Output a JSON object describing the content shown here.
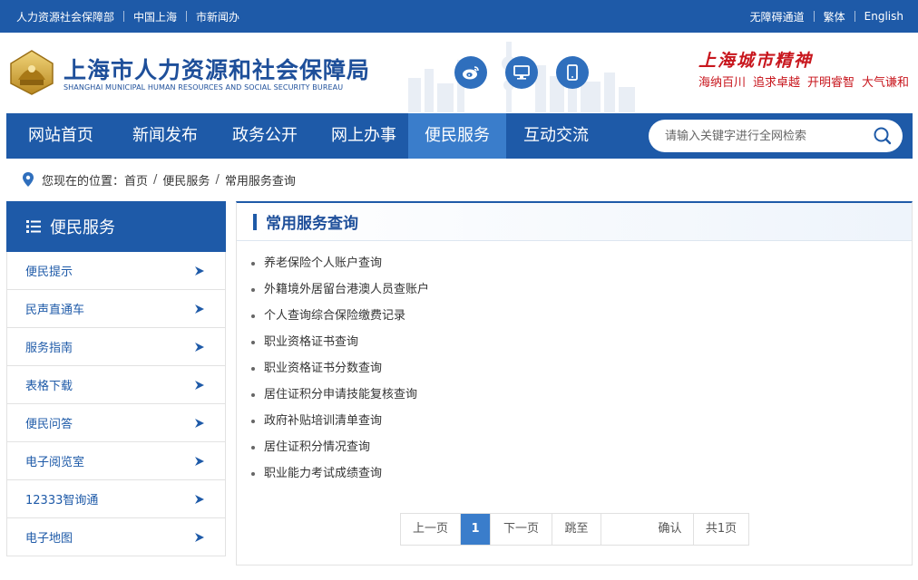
{
  "topbar": {
    "left_links": [
      "人力资源社会保障部",
      "中国上海",
      "市新闻办"
    ],
    "right_links": [
      "无障碍通道",
      "繁体",
      "English"
    ]
  },
  "header": {
    "site_name": "上海市人力资源和社会保障局",
    "site_name_en": "SHANGHAI MUNICIPAL HUMAN RESOURCES AND SOCIAL SECURITY BUREAU",
    "spirit_title": "上海城市精神",
    "spirit_words": [
      "海纳百川",
      "追求卓越",
      "开明睿智",
      "大气谦和"
    ],
    "social_icons": [
      "weibo-icon",
      "pc-icon",
      "mobile-icon"
    ]
  },
  "nav": {
    "items": [
      "网站首页",
      "新闻发布",
      "政务公开",
      "网上办事",
      "便民服务",
      "互动交流"
    ],
    "active": "便民服务",
    "search_placeholder": "请输入关键字进行全网检索"
  },
  "breadcrumb": {
    "label": "您现在的位置：",
    "items": [
      "首页",
      "便民服务",
      "常用服务查询"
    ]
  },
  "sidebar": {
    "title": "便民服务",
    "items": [
      "便民提示",
      "民声直通车",
      "服务指南",
      "表格下载",
      "便民问答",
      "电子阅览室",
      "12333智询通",
      "电子地图"
    ]
  },
  "content": {
    "title": "常用服务查询",
    "items": [
      "养老保险个人账户查询",
      "外籍境外居留台港澳人员查账户",
      "个人查询综合保险缴费记录",
      "职业资格证书查询",
      "职业资格证书分数查询",
      "居住证积分申请技能复核查询",
      "政府补贴培训清单查询",
      "居住证积分情况查询",
      "职业能力考试成绩查询"
    ]
  },
  "pagination": {
    "prev": "上一页",
    "current": "1",
    "next": "下一页",
    "goto": "跳至",
    "confirm": "确认",
    "total": "共1页"
  },
  "colors": {
    "primary": "#1e5aa8",
    "active_nav": "#3a7dcb",
    "accent_red": "#c8161d"
  }
}
